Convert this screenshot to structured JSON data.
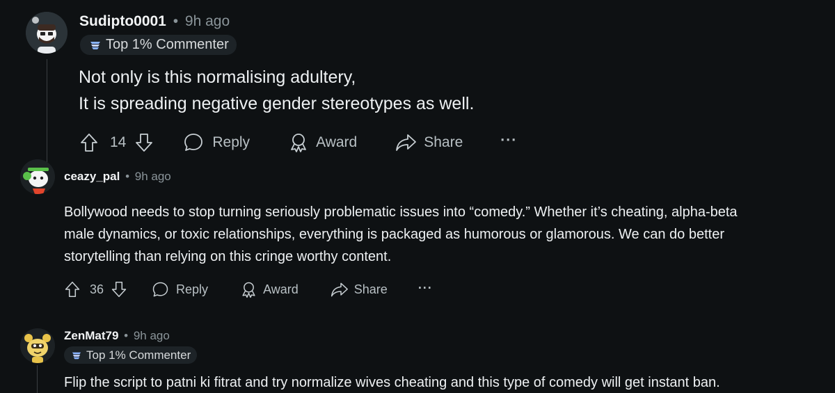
{
  "comments": [
    {
      "author": "Sudipto0001",
      "time": "9h ago",
      "badge": "Top 1% Commenter",
      "lines": [
        "Not only is this normalising adultery,",
        "It is spreading negative gender stereotypes as well."
      ],
      "votes": "14",
      "reply": "Reply",
      "award": "Award",
      "share": "Share",
      "more": "···"
    },
    {
      "author": "ceazy_pal",
      "time": "9h ago",
      "lines": [
        "Bollywood needs to stop turning seriously problematic issues into “comedy.” Whether it’s cheating, alpha-beta",
        "male dynamics, or toxic relationships, everything is packaged as humorous or glamorous. We can do better",
        "storytelling than relying on this cringe worthy content."
      ],
      "votes": "36",
      "reply": "Reply",
      "award": "Award",
      "share": "Share",
      "more": "···"
    },
    {
      "author": "ZenMat79",
      "time": "9h ago",
      "badge": "Top 1% Commenter",
      "lines": [
        "Flip the script to patni ki fitrat and try normalize wives cheating and this type of comedy will get instant ban."
      ]
    }
  ],
  "meta_separator": "•",
  "icons": {
    "upvote": "arrow-up-outline-icon",
    "downvote": "arrow-down-outline-icon",
    "reply": "speech-bubble-icon",
    "award": "award-ribbon-icon",
    "share": "share-arrow-icon",
    "badge": "top-commenter-badge-icon"
  },
  "colors": {
    "background": "#0e1113",
    "text": "#d7dadc",
    "muted": "#8a9499",
    "badge_bg": "#1d2327"
  }
}
